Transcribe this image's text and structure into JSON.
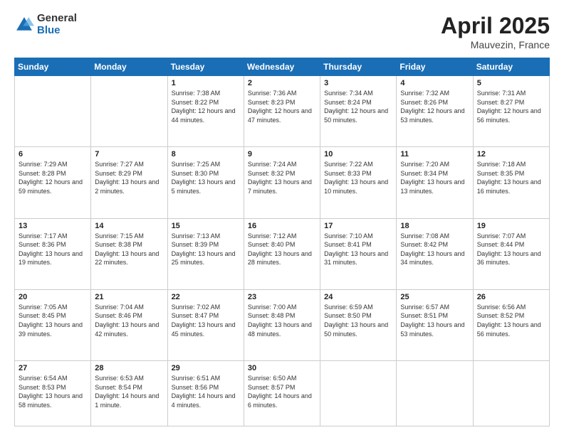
{
  "header": {
    "logo_general": "General",
    "logo_blue": "Blue",
    "title": "April 2025",
    "location": "Mauvezin, France"
  },
  "weekdays": [
    "Sunday",
    "Monday",
    "Tuesday",
    "Wednesday",
    "Thursday",
    "Friday",
    "Saturday"
  ],
  "weeks": [
    [
      null,
      null,
      {
        "day": 1,
        "sunrise": "7:38 AM",
        "sunset": "8:22 PM",
        "daylight": "12 hours and 44 minutes."
      },
      {
        "day": 2,
        "sunrise": "7:36 AM",
        "sunset": "8:23 PM",
        "daylight": "12 hours and 47 minutes."
      },
      {
        "day": 3,
        "sunrise": "7:34 AM",
        "sunset": "8:24 PM",
        "daylight": "12 hours and 50 minutes."
      },
      {
        "day": 4,
        "sunrise": "7:32 AM",
        "sunset": "8:26 PM",
        "daylight": "12 hours and 53 minutes."
      },
      {
        "day": 5,
        "sunrise": "7:31 AM",
        "sunset": "8:27 PM",
        "daylight": "12 hours and 56 minutes."
      }
    ],
    [
      {
        "day": 6,
        "sunrise": "7:29 AM",
        "sunset": "8:28 PM",
        "daylight": "12 hours and 59 minutes."
      },
      {
        "day": 7,
        "sunrise": "7:27 AM",
        "sunset": "8:29 PM",
        "daylight": "13 hours and 2 minutes."
      },
      {
        "day": 8,
        "sunrise": "7:25 AM",
        "sunset": "8:30 PM",
        "daylight": "13 hours and 5 minutes."
      },
      {
        "day": 9,
        "sunrise": "7:24 AM",
        "sunset": "8:32 PM",
        "daylight": "13 hours and 7 minutes."
      },
      {
        "day": 10,
        "sunrise": "7:22 AM",
        "sunset": "8:33 PM",
        "daylight": "13 hours and 10 minutes."
      },
      {
        "day": 11,
        "sunrise": "7:20 AM",
        "sunset": "8:34 PM",
        "daylight": "13 hours and 13 minutes."
      },
      {
        "day": 12,
        "sunrise": "7:18 AM",
        "sunset": "8:35 PM",
        "daylight": "13 hours and 16 minutes."
      }
    ],
    [
      {
        "day": 13,
        "sunrise": "7:17 AM",
        "sunset": "8:36 PM",
        "daylight": "13 hours and 19 minutes."
      },
      {
        "day": 14,
        "sunrise": "7:15 AM",
        "sunset": "8:38 PM",
        "daylight": "13 hours and 22 minutes."
      },
      {
        "day": 15,
        "sunrise": "7:13 AM",
        "sunset": "8:39 PM",
        "daylight": "13 hours and 25 minutes."
      },
      {
        "day": 16,
        "sunrise": "7:12 AM",
        "sunset": "8:40 PM",
        "daylight": "13 hours and 28 minutes."
      },
      {
        "day": 17,
        "sunrise": "7:10 AM",
        "sunset": "8:41 PM",
        "daylight": "13 hours and 31 minutes."
      },
      {
        "day": 18,
        "sunrise": "7:08 AM",
        "sunset": "8:42 PM",
        "daylight": "13 hours and 34 minutes."
      },
      {
        "day": 19,
        "sunrise": "7:07 AM",
        "sunset": "8:44 PM",
        "daylight": "13 hours and 36 minutes."
      }
    ],
    [
      {
        "day": 20,
        "sunrise": "7:05 AM",
        "sunset": "8:45 PM",
        "daylight": "13 hours and 39 minutes."
      },
      {
        "day": 21,
        "sunrise": "7:04 AM",
        "sunset": "8:46 PM",
        "daylight": "13 hours and 42 minutes."
      },
      {
        "day": 22,
        "sunrise": "7:02 AM",
        "sunset": "8:47 PM",
        "daylight": "13 hours and 45 minutes."
      },
      {
        "day": 23,
        "sunrise": "7:00 AM",
        "sunset": "8:48 PM",
        "daylight": "13 hours and 48 minutes."
      },
      {
        "day": 24,
        "sunrise": "6:59 AM",
        "sunset": "8:50 PM",
        "daylight": "13 hours and 50 minutes."
      },
      {
        "day": 25,
        "sunrise": "6:57 AM",
        "sunset": "8:51 PM",
        "daylight": "13 hours and 53 minutes."
      },
      {
        "day": 26,
        "sunrise": "6:56 AM",
        "sunset": "8:52 PM",
        "daylight": "13 hours and 56 minutes."
      }
    ],
    [
      {
        "day": 27,
        "sunrise": "6:54 AM",
        "sunset": "8:53 PM",
        "daylight": "13 hours and 58 minutes."
      },
      {
        "day": 28,
        "sunrise": "6:53 AM",
        "sunset": "8:54 PM",
        "daylight": "14 hours and 1 minute."
      },
      {
        "day": 29,
        "sunrise": "6:51 AM",
        "sunset": "8:56 PM",
        "daylight": "14 hours and 4 minutes."
      },
      {
        "day": 30,
        "sunrise": "6:50 AM",
        "sunset": "8:57 PM",
        "daylight": "14 hours and 6 minutes."
      },
      null,
      null,
      null
    ]
  ],
  "labels": {
    "sunrise": "Sunrise:",
    "sunset": "Sunset:",
    "daylight": "Daylight:"
  }
}
